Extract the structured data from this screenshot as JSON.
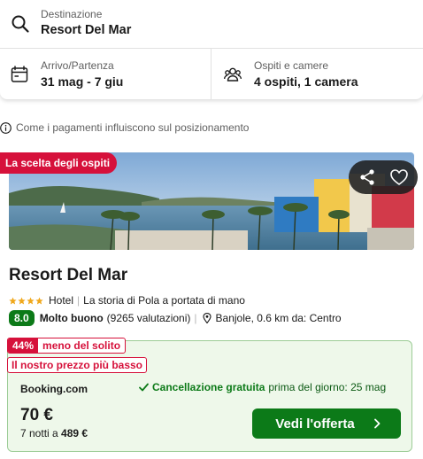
{
  "search": {
    "destination_label": "Destinazione",
    "destination_value": "Resort Del Mar",
    "dates_label": "Arrivo/Partenza",
    "dates_value": "31 mag - 7 giu",
    "guests_label": "Ospiti e camere",
    "guests_value": "4 ospiti, 1 camera"
  },
  "ranking_note": "Come i pagamenti influiscono sul posizionamento",
  "hotel": {
    "badge": "La scelta degli ospiti",
    "name": "Resort Del Mar",
    "stars": 4,
    "type": "Hotel",
    "tagline": "La storia di Pola a portata di mano",
    "score": "8.0",
    "rating_word": "Molto buono",
    "reviews": "(9265 valutazioni)",
    "location": "Banjole, 0.6 km da: Centro"
  },
  "deal": {
    "discount_pct": "44%",
    "discount_text": "meno del solito",
    "lowest_price_badge": "Il nostro prezzo più basso",
    "provider": "Booking.com",
    "cancellation_strong": "Cancellazione gratuita",
    "cancellation_rest": "prima del giorno: 25 mag",
    "price": "70 €",
    "nights_text": "7 notti a",
    "total": "489 €",
    "cta": "Vedi l'offerta"
  },
  "icons": {
    "destination": "search-icon",
    "dates": "calendar-icon",
    "guests": "people-icon",
    "info": "info-icon",
    "share": "share-icon",
    "favorite": "heart-icon",
    "location": "pin-icon",
    "check": "check-icon",
    "cta": "chevron-right-icon"
  },
  "colors": {
    "brand_red": "#d6113b",
    "success_green": "#0c7a18",
    "deal_bg": "#eef8ea"
  }
}
